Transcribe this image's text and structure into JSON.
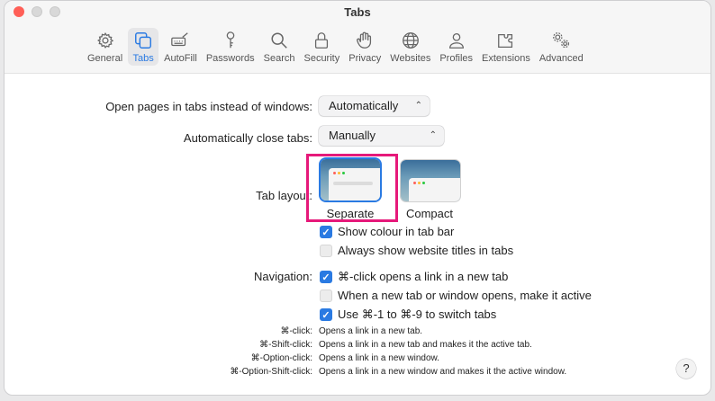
{
  "window": {
    "title": "Tabs"
  },
  "toolbar": {
    "items": [
      {
        "label": "General",
        "icon": "gear-icon"
      },
      {
        "label": "Tabs",
        "icon": "tabs-icon",
        "active": true
      },
      {
        "label": "AutoFill",
        "icon": "autofill-icon"
      },
      {
        "label": "Passwords",
        "icon": "key-icon"
      },
      {
        "label": "Search",
        "icon": "search-icon"
      },
      {
        "label": "Security",
        "icon": "lock-icon"
      },
      {
        "label": "Privacy",
        "icon": "hand-icon"
      },
      {
        "label": "Websites",
        "icon": "globe-icon"
      },
      {
        "label": "Profiles",
        "icon": "person-icon"
      },
      {
        "label": "Extensions",
        "icon": "extensions-icon"
      },
      {
        "label": "Advanced",
        "icon": "gears-icon"
      }
    ]
  },
  "settings": {
    "open_pages_label": "Open pages in tabs instead of windows:",
    "open_pages_value": "Automatically",
    "close_tabs_label": "Automatically close tabs:",
    "close_tabs_value": "Manually",
    "tab_layout_label": "Tab layout:",
    "layout_separate": "Separate",
    "layout_compact": "Compact",
    "show_colour": "Show colour in tab bar",
    "show_titles": "Always show website titles in tabs",
    "navigation_label": "Navigation:",
    "cmd_click_new_tab": "⌘-click opens a link in a new tab",
    "make_active": "When a new tab or window opens, make it active",
    "use_cmd_numbers": "Use ⌘-1 to ⌘-9 to switch tabs"
  },
  "shortcuts": [
    {
      "key": "⌘-click:",
      "desc": "Opens a link in a new tab."
    },
    {
      "key": "⌘-Shift-click:",
      "desc": "Opens a link in a new tab and makes it the active tab."
    },
    {
      "key": "⌘-Option-click:",
      "desc": "Opens a link in a new window."
    },
    {
      "key": "⌘-Option-Shift-click:",
      "desc": "Opens a link in a new window and makes it the active window."
    }
  ],
  "help": {
    "label": "?"
  },
  "colors": {
    "accent": "#2a7ae2",
    "highlight": "#e6197a"
  }
}
